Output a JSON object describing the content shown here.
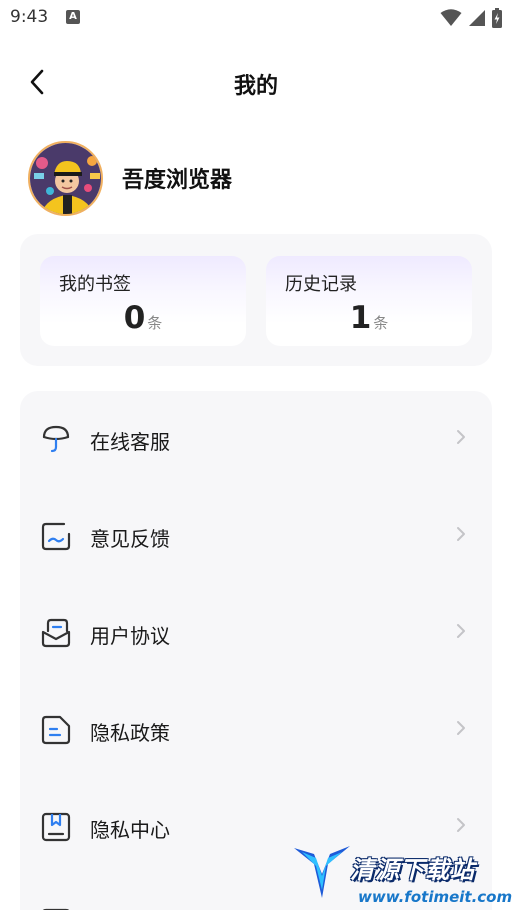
{
  "status_bar": {
    "time": "9:43",
    "notification_icon": "A"
  },
  "header": {
    "back_icon": "chevron-left-icon",
    "title": "我的"
  },
  "profile": {
    "name": "吾度浏览器"
  },
  "stats": [
    {
      "label": "我的书签",
      "value": "0",
      "unit": "条"
    },
    {
      "label": "历史记录",
      "value": "1",
      "unit": "条"
    }
  ],
  "menu": [
    {
      "label": "在线客服",
      "icon": "customer-service-icon"
    },
    {
      "label": "意见反馈",
      "icon": "feedback-icon"
    },
    {
      "label": "用户协议",
      "icon": "user-agreement-icon"
    },
    {
      "label": "隐私政策",
      "icon": "privacy-policy-icon"
    },
    {
      "label": "隐私中心",
      "icon": "privacy-center-icon"
    }
  ],
  "watermark": {
    "title": "清源下载站",
    "url": "www.fotimeit.com"
  },
  "colors": {
    "accent_blue": "#2f7ff0",
    "card_bg": "#f7f7f9",
    "arrow": "#c4c4c8"
  }
}
